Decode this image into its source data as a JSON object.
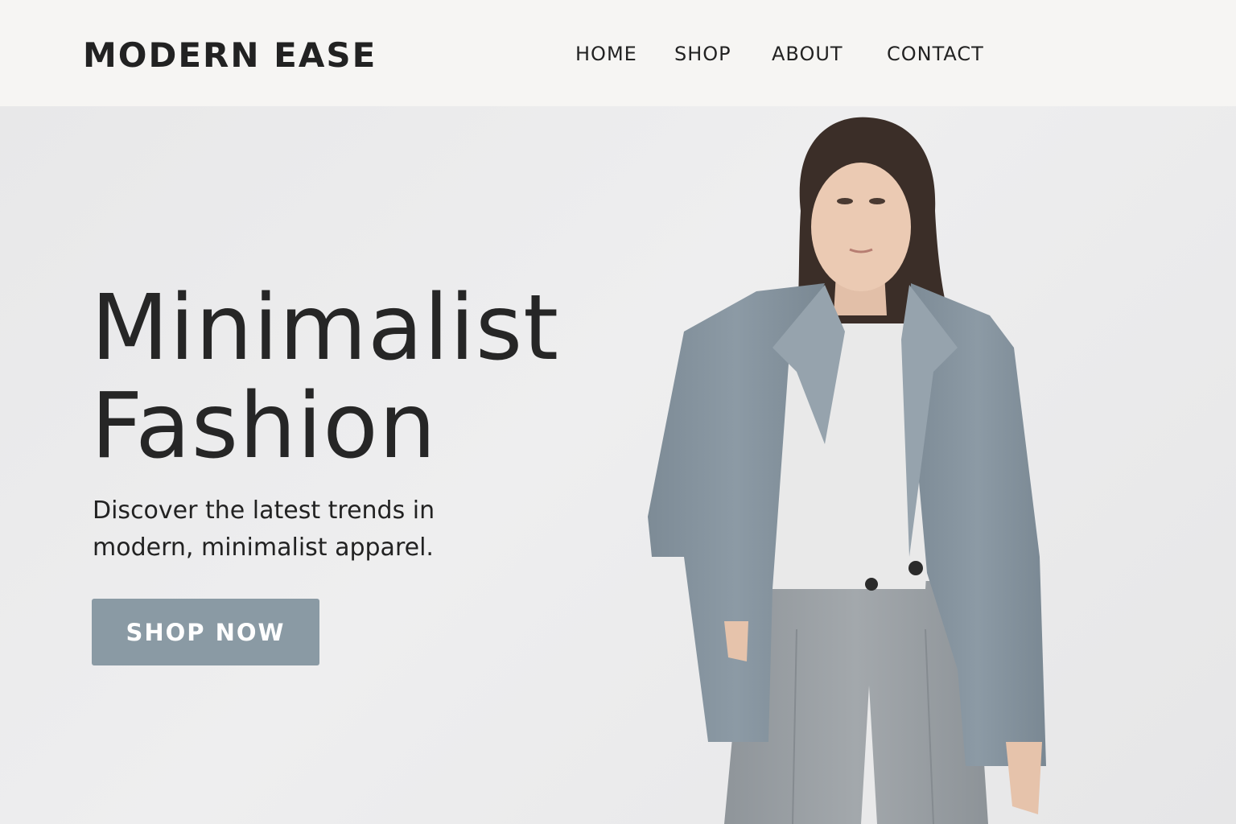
{
  "header": {
    "logo": "MODERN EASE",
    "nav": [
      {
        "label": "HOME"
      },
      {
        "label": "SHOP"
      },
      {
        "label": "ABOUT"
      },
      {
        "label": "CONTACT"
      }
    ]
  },
  "hero": {
    "headline_line1": "Minimalist",
    "headline_line2": "Fashion",
    "subtitle": "Discover the latest trends in modern, minimalist apparel.",
    "cta_label": "SHOP NOW"
  },
  "colors": {
    "header_bg": "#f6f5f3",
    "hero_bg": "#ececec",
    "cta_bg": "#8a9aa4",
    "text": "#222222",
    "blazer": "#8896a1",
    "trousers": "#9aa0a5"
  },
  "icons": [
    "model-photo"
  ]
}
